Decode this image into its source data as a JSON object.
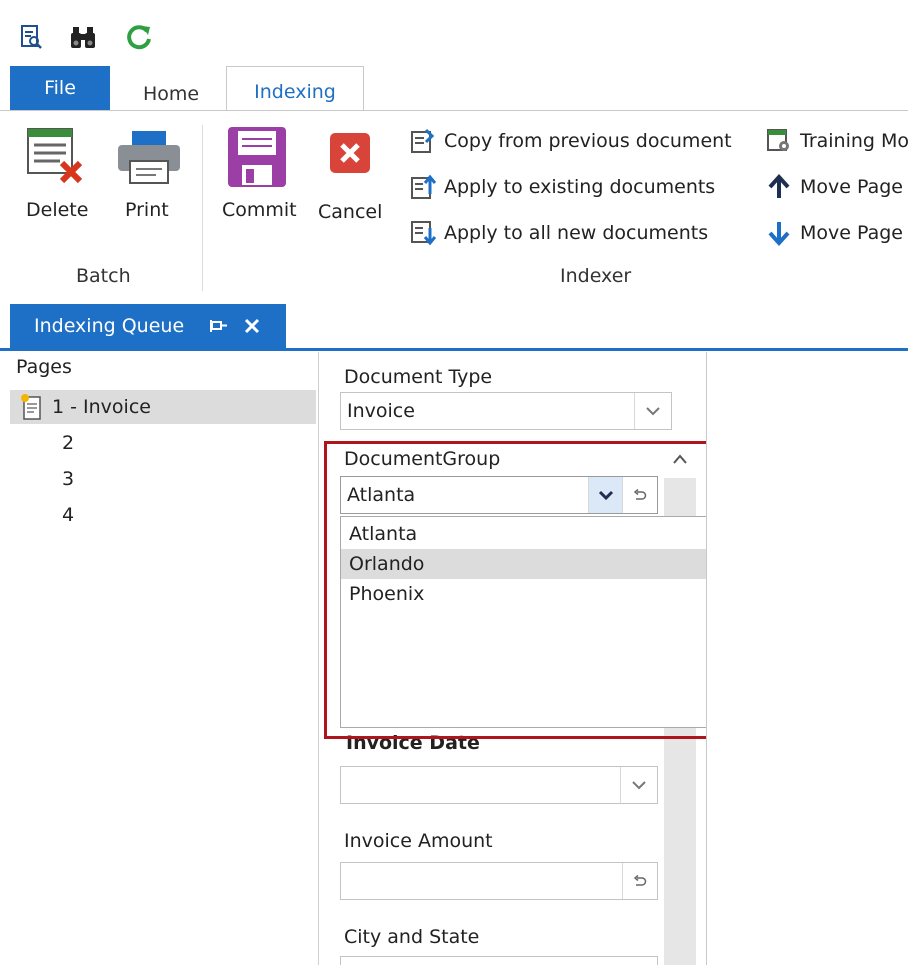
{
  "ribbon": {
    "tabs": [
      {
        "label": "File"
      },
      {
        "label": "Home"
      },
      {
        "label": "Indexing"
      }
    ],
    "batch_group": {
      "label": "Batch",
      "delete_label": "Delete",
      "print_label": "Print"
    },
    "indexer_group": {
      "label": "Indexer",
      "commit_label": "Commit",
      "cancel_label": "Cancel",
      "copy_prev_label": "Copy from previous document",
      "apply_existing_label": "Apply to existing documents",
      "apply_new_label": "Apply to all new documents"
    },
    "extra": {
      "training_label": "Training Mo",
      "move_up_label": "Move Page",
      "move_down_label": "Move Page"
    }
  },
  "panel": {
    "tab_label": "Indexing Queue"
  },
  "pages": {
    "header": "Pages",
    "items": [
      {
        "label": "1 - Invoice"
      },
      {
        "label": "2"
      },
      {
        "label": "3"
      },
      {
        "label": "4"
      }
    ]
  },
  "form": {
    "document_type": {
      "label": "Document Type",
      "value": "Invoice"
    },
    "document_group": {
      "label": "DocumentGroup",
      "value": "Atlanta",
      "options": [
        "Atlanta",
        "Orlando",
        "Phoenix"
      ]
    },
    "invoice_date": {
      "label": "Invoice Date",
      "value": ""
    },
    "invoice_amount": {
      "label": "Invoice Amount",
      "value": ""
    },
    "city_state": {
      "label": "City and State"
    }
  },
  "colors": {
    "accent": "#1e6fc6",
    "highlight_border": "#b0141c",
    "selected_row": "#dcdcdc"
  }
}
